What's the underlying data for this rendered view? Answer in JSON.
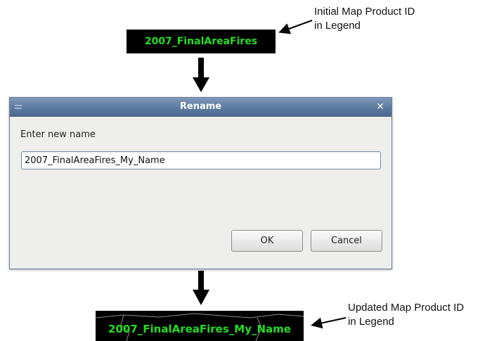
{
  "legend": {
    "initial_id": "2007_FinalAreaFires",
    "updated_id": "2007_FinalAreaFires_My_Name",
    "text_color": "#22dd22",
    "background": "#000000"
  },
  "callouts": {
    "initial": [
      "Initial Map Product ID",
      "in Legend"
    ],
    "updated": [
      "Updated Map Product ID",
      "in Legend"
    ]
  },
  "dialog": {
    "title": "Rename",
    "close_icon": "close-x",
    "prompt": "Enter new name",
    "input_value": "2007_FinalAreaFires_My_Name",
    "ok_label": "OK",
    "cancel_label": "Cancel",
    "titlebar_color": "#5d7aa0"
  }
}
